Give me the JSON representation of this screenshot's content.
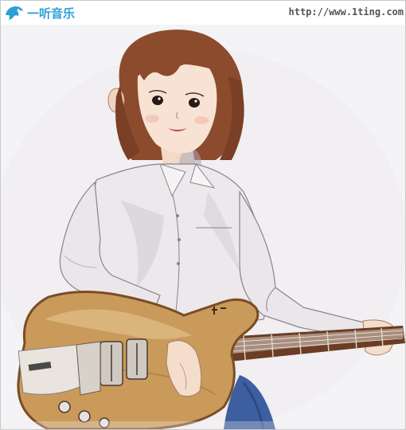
{
  "watermark": {
    "logo_text": "一听音乐",
    "url": "http://www.1ting.com",
    "logo_icon": "dolphin-icon",
    "brand_color": "#2a9fd8"
  },
  "illustration": {
    "subject_icon": "girl-with-electric-guitar-illustration",
    "palette": {
      "background": "#f3f2f4",
      "hair": "#8a4a2c",
      "skin": "#f6e0d2",
      "shirt": "#ebe7ea",
      "guitar_body": "#c99a5a",
      "guitar_edge": "#8b5a2e",
      "jeans": "#3a5a99"
    }
  }
}
